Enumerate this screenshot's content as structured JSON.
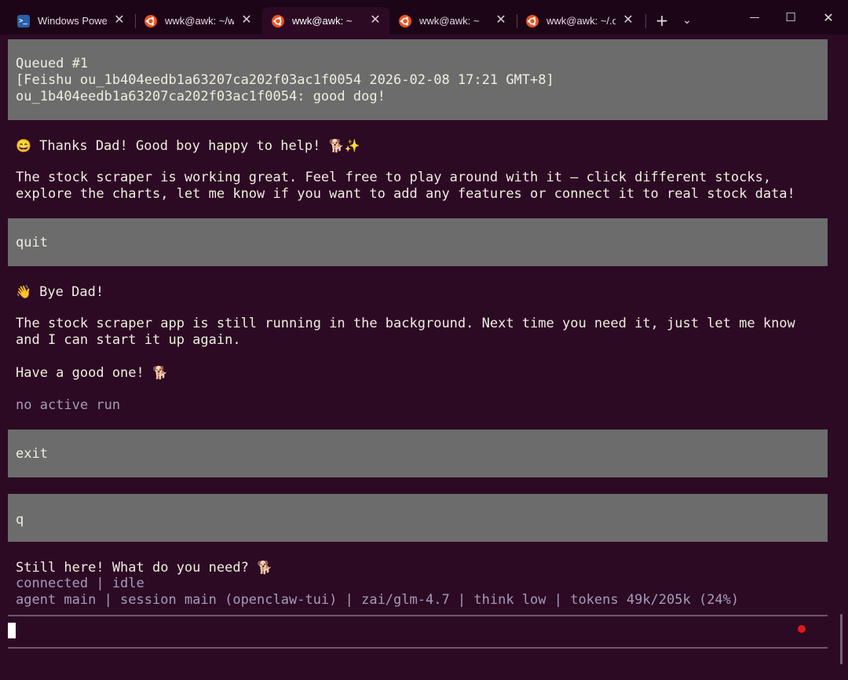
{
  "tabs": [
    {
      "label": "Windows Powe",
      "icon": "powershell-icon"
    },
    {
      "label": "wwk@awk: ~/w",
      "icon": "ubuntu-icon"
    },
    {
      "label": "wwk@awk: ~",
      "icon": "ubuntu-icon",
      "active": true
    },
    {
      "label": "wwk@awk: ~",
      "icon": "ubuntu-icon"
    },
    {
      "label": "wwk@awk: ~/.c",
      "icon": "ubuntu-icon"
    }
  ],
  "tab_close_glyph": "✕",
  "new_tab_glyph": "+",
  "dropdown_glyph": "⌄",
  "window_controls": {
    "minimize": "—",
    "maximize": "☐",
    "close": "✕"
  },
  "terminal": {
    "queued": {
      "line1": "Queued #1",
      "line2": "[Feishu ou_1b404eedb1a63207ca202f03ac1f0054 2026-02-08 17:21 GMT+8]",
      "line3": "ou_1b404eedb1a63207ca202f03ac1f0054: good dog!"
    },
    "reply1": {
      "emoji": "😄",
      "greeting": "Thanks Dad! Good boy happy to help!",
      "trail_emoji": "🐕✨",
      "para1": "The stock scraper is working great. Feel free to play around with it — click different stocks,",
      "para2": "explore the charts, let me know if you want to add any features or connect it to real stock data!"
    },
    "input_quit": "quit",
    "reply2": {
      "emoji": "👋",
      "greeting": "Bye Dad!",
      "para1": "The stock scraper app is still running in the background. Next time you need it, just let me know",
      "para2": "and I can start it up again.",
      "closing": "Have a good one!",
      "closing_emoji": "🐕"
    },
    "status_no_run": "no active run",
    "input_exit": "exit",
    "input_q": "q",
    "reply3": {
      "text": "Still here! What do you need?",
      "emoji": "🐕"
    },
    "status_line1": "connected | idle",
    "status_line2": "agent main | session main (openclaw-tui) | zai/glm-4.7 | think low | tokens 49k/205k (24%)"
  },
  "colors": {
    "background": "#2c0a24",
    "input_block": "#6c6c6c",
    "text": "#f0eedf",
    "dim_text": "#a59bb8",
    "ubuntu_orange": "#e95420",
    "record_dot": "#e01818"
  }
}
